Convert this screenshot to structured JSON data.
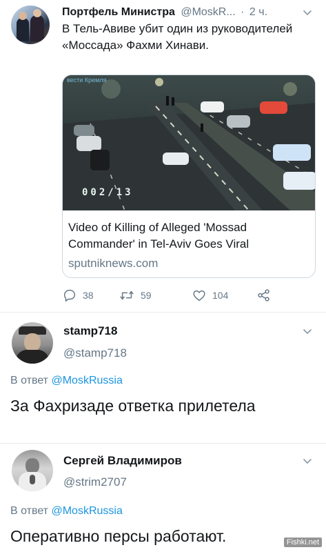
{
  "tweet": {
    "author_name": "Портфель Министра",
    "author_handle": "@MoskR...",
    "separator": "·",
    "time": "2 ч.",
    "text": "В Тель-Авиве убит один из руководителей «Моссада» Фахми Хинави.",
    "card": {
      "watermark": "вести Кремля",
      "video_timestamp": "002/13",
      "title": "Video of Killing of Alleged 'Mossad Commander' in Tel-Aviv Goes Viral",
      "domain": "sputniknews.com"
    },
    "actions": {
      "reply_count": "38",
      "retweet_count": "59",
      "like_count": "104"
    }
  },
  "replies": [
    {
      "author_name": "stamp718",
      "author_handle": "@stamp718",
      "replying_prefix": "В ответ",
      "replying_to": "@MoskRussia",
      "text": "За Фахризаде ответка прилетела"
    },
    {
      "author_name": "Сергей Владимиров",
      "author_handle": "@strim2707",
      "replying_prefix": "В ответ",
      "replying_to": "@MoskRussia",
      "text": "Оперативно персы работают."
    }
  ],
  "site_watermark": "Fishki.net",
  "colors": {
    "text": "#14171a",
    "muted": "#657786",
    "link": "#1b95e0",
    "border": "#ccd6dd"
  }
}
